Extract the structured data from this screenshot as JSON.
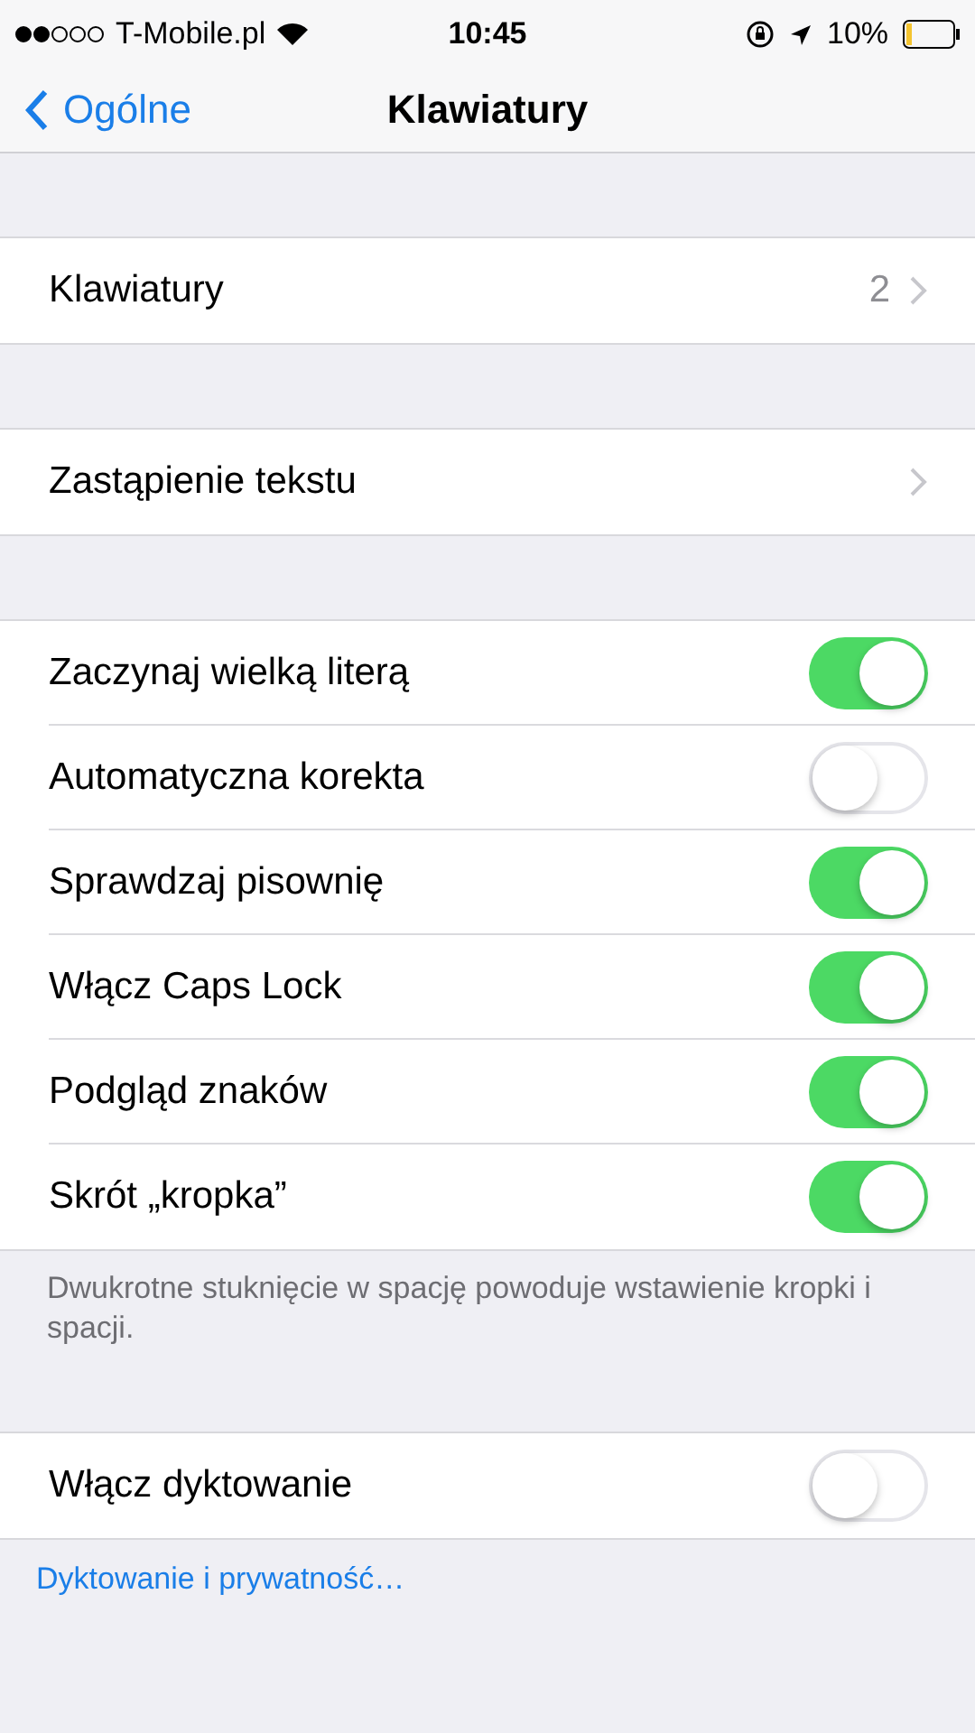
{
  "status_bar": {
    "carrier": "T-Mobile.pl",
    "time": "10:45",
    "battery": "10%"
  },
  "nav": {
    "back": "Ogólne",
    "title": "Klawiatury"
  },
  "groups": [
    {
      "rows": [
        {
          "kind": "disclosure",
          "label": "Klawiatury",
          "value": "2"
        }
      ]
    },
    {
      "rows": [
        {
          "kind": "disclosure",
          "label": "Zastąpienie tekstu"
        }
      ]
    },
    {
      "rows": [
        {
          "kind": "toggle",
          "label": "Zaczynaj wielką literą",
          "on": true
        },
        {
          "kind": "toggle",
          "label": "Automatyczna korekta",
          "on": false
        },
        {
          "kind": "toggle",
          "label": "Sprawdzaj pisownię",
          "on": true
        },
        {
          "kind": "toggle",
          "label": "Włącz Caps Lock",
          "on": true
        },
        {
          "kind": "toggle",
          "label": "Podgląd znaków",
          "on": true
        },
        {
          "kind": "toggle",
          "label": "Skrót „kropka”",
          "on": true
        }
      ],
      "footer": "Dwukrotne stuknięcie w spację powoduje wstawienie kropki i spacji."
    },
    {
      "rows": [
        {
          "kind": "toggle",
          "label": "Włącz dyktowanie",
          "on": false
        }
      ],
      "link": "Dyktowanie i prywatność…"
    }
  ]
}
